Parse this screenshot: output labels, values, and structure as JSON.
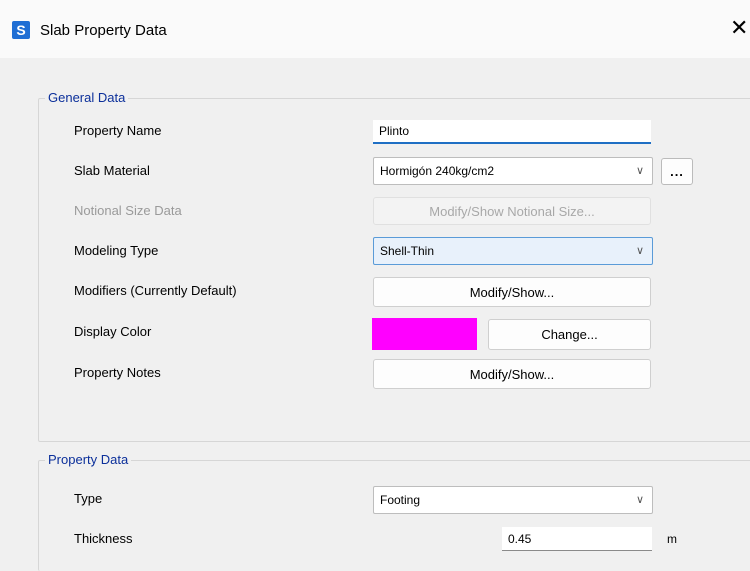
{
  "window": {
    "app_icon_letter": "S",
    "title": "Slab Property Data",
    "close_glyph": "✕"
  },
  "general_data": {
    "legend": "General Data",
    "property_name": {
      "label": "Property Name",
      "value": "Plinto"
    },
    "slab_material": {
      "label": "Slab Material",
      "value": "Hormigón 240kg/cm2",
      "browse_label": "..."
    },
    "notional_size": {
      "label": "Notional Size Data",
      "button_label": "Modify/Show Notional Size..."
    },
    "modeling_type": {
      "label": "Modeling Type",
      "value": "Shell-Thin"
    },
    "modifiers": {
      "label": "Modifiers (Currently Default)",
      "button_label": "Modify/Show..."
    },
    "display_color": {
      "label": "Display Color",
      "color": "#ff00ff",
      "button_label": "Change..."
    },
    "property_notes": {
      "label": "Property Notes",
      "button_label": "Modify/Show..."
    }
  },
  "property_data": {
    "legend": "Property Data",
    "type": {
      "label": "Type",
      "value": "Footing"
    },
    "thickness": {
      "label": "Thickness",
      "value": "0.45",
      "unit": "m"
    }
  },
  "icons": {
    "dropdown": "chevron-down-icon",
    "close": "close-icon",
    "app": "app-s-icon"
  }
}
